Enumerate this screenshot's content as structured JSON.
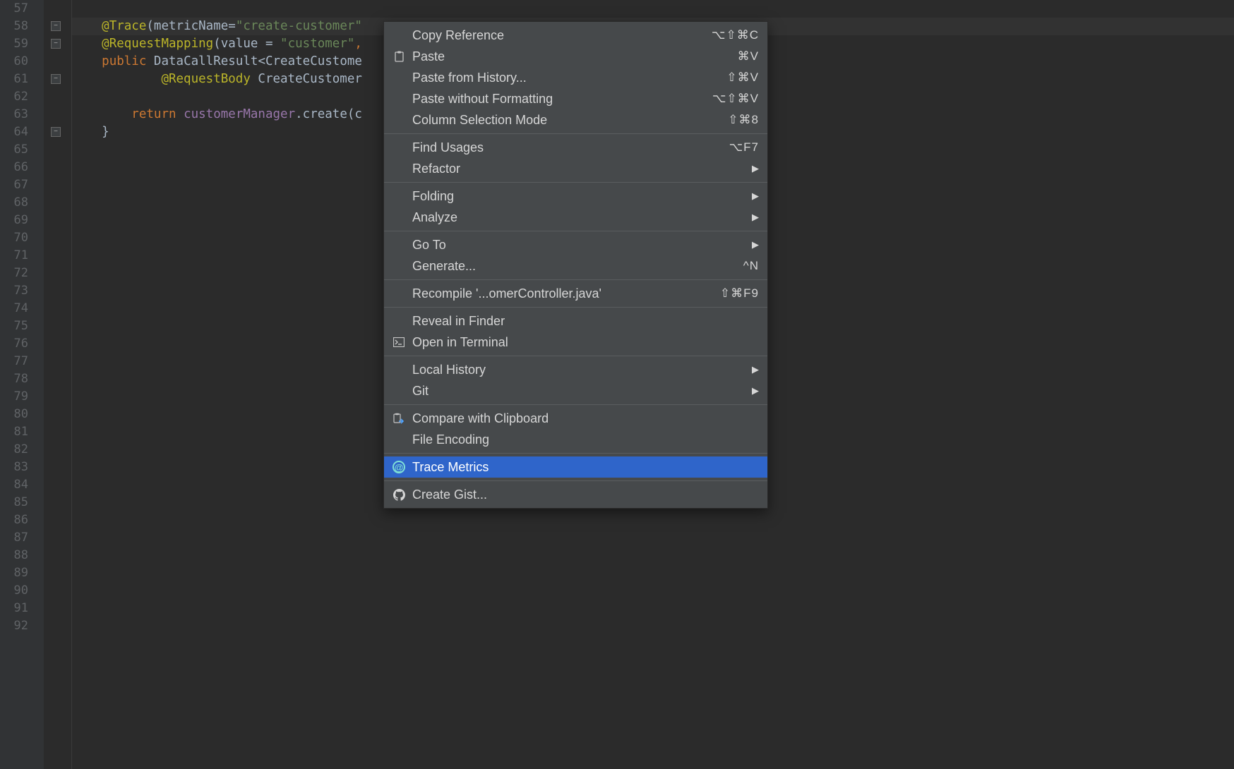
{
  "code": {
    "line_start": 57,
    "line_end": 92,
    "lines": {
      "58": {
        "annotation": "@Trace",
        "attr": "metricName",
        "eq": "=",
        "string": "\"create-customer\""
      },
      "59": {
        "annotation": "@RequestMapping",
        "attr": "value",
        "eq": " = ",
        "string": "\"customer\"",
        "trail": ","
      },
      "60": {
        "keyword": "public ",
        "type": "DataCallResult",
        "lt": "<",
        "gen": "CreateCustome"
      },
      "61": {
        "annotation": "@RequestBody",
        "type": " CreateCustomer"
      },
      "63": {
        "keyword": "return ",
        "field": "customerManager",
        "dot": ".",
        "method": "create",
        "paren": "(",
        "arg": "c"
      },
      "64": {
        "brace": "}"
      }
    }
  },
  "menu": {
    "groups": [
      {
        "items": [
          {
            "icon": "",
            "label": "Copy Reference",
            "shortcut": "⌥⇧⌘C"
          },
          {
            "icon": "paste",
            "label": "Paste",
            "shortcut": "⌘V"
          },
          {
            "icon": "",
            "label": "Paste from History...",
            "shortcut": "⇧⌘V"
          },
          {
            "icon": "",
            "label": "Paste without Formatting",
            "shortcut": "⌥⇧⌘V"
          },
          {
            "icon": "",
            "label": "Column Selection Mode",
            "shortcut": "⇧⌘8"
          }
        ]
      },
      {
        "items": [
          {
            "icon": "",
            "label": "Find Usages",
            "shortcut": "⌥F7"
          },
          {
            "icon": "",
            "label": "Refactor",
            "submenu": true
          }
        ]
      },
      {
        "items": [
          {
            "icon": "",
            "label": "Folding",
            "submenu": true
          },
          {
            "icon": "",
            "label": "Analyze",
            "submenu": true
          }
        ]
      },
      {
        "items": [
          {
            "icon": "",
            "label": "Go To",
            "submenu": true
          },
          {
            "icon": "",
            "label": "Generate...",
            "shortcut": "^N"
          }
        ]
      },
      {
        "items": [
          {
            "icon": "",
            "label": "Recompile '...omerController.java'",
            "shortcut": "⇧⌘F9"
          }
        ]
      },
      {
        "items": [
          {
            "icon": "",
            "label": "Reveal in Finder"
          },
          {
            "icon": "terminal",
            "label": "Open in Terminal"
          }
        ]
      },
      {
        "items": [
          {
            "icon": "",
            "label": "Local History",
            "submenu": true
          },
          {
            "icon": "",
            "label": "Git",
            "submenu": true
          }
        ]
      },
      {
        "items": [
          {
            "icon": "clipboard-compare",
            "label": "Compare with Clipboard"
          },
          {
            "icon": "",
            "label": "File Encoding"
          }
        ]
      },
      {
        "items": [
          {
            "icon": "at",
            "label": "Trace Metrics",
            "selected": true
          }
        ]
      },
      {
        "items": [
          {
            "icon": "github",
            "label": "Create Gist..."
          }
        ]
      }
    ]
  }
}
